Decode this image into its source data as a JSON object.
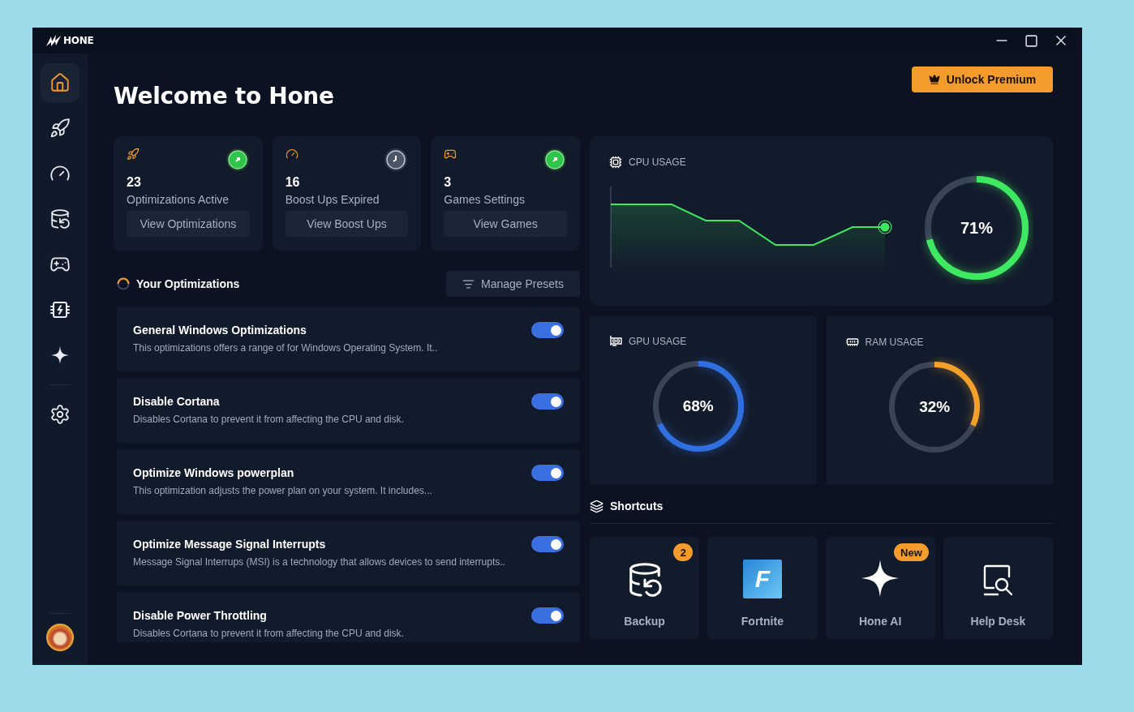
{
  "window": {
    "logo": "HONE"
  },
  "sidebar": {
    "items": [
      {
        "kind": "home",
        "selected": true
      },
      {
        "kind": "rocket",
        "selected": false
      },
      {
        "kind": "gauge",
        "selected": false
      },
      {
        "kind": "backup",
        "selected": false
      },
      {
        "kind": "gamepad",
        "selected": false
      },
      {
        "kind": "chip",
        "selected": false
      },
      {
        "kind": "sparkle",
        "selected": false
      },
      {
        "kind": "settings",
        "selected": false
      }
    ]
  },
  "header": {
    "title": "Welcome to Hone",
    "premium_button": "Unlock Premium"
  },
  "stats": [
    {
      "kind": "rocket",
      "count": "23",
      "label": "Optimizations Active",
      "button": "View Optimizations",
      "on": true
    },
    {
      "kind": "gauge",
      "count": "16",
      "label": "Boost Ups Expired",
      "button": "View Boost Ups",
      "on": false
    },
    {
      "kind": "gamepad",
      "count": "3",
      "label": "Games Settings",
      "button": "View Games",
      "on": true
    }
  ],
  "optimizations": {
    "title": "Your Optimizations",
    "presets_button": "Manage Presets",
    "items": [
      {
        "title": "General Windows Optimizations",
        "description": "This optimizations offers a range of for Windows Operating System. It..",
        "on": true
      },
      {
        "title": "Disable Cortana",
        "description": "Disables Cortana to prevent it from affecting the CPU and disk.",
        "on": true
      },
      {
        "title": "Optimize Windows powerplan",
        "description": "This optimization adjusts the power plan on your system. It includes...",
        "on": true
      },
      {
        "title": "Optimize Message Signal Interrupts",
        "description": "Message Signal Interrups (MSI) is a technology that allows devices to send interrupts..",
        "on": true
      },
      {
        "title": "Disable Power Throttling",
        "description": "Disables Cortana to prevent it from affecting the CPU and disk.",
        "on": true
      }
    ]
  },
  "usage": [
    {
      "kind": "cpu",
      "title": "CPU USAGE",
      "level": 0.71,
      "reading": "71%",
      "color": "#3ee860"
    },
    {
      "kind": "gpu",
      "title": "GPU USAGE",
      "level": 0.68,
      "reading": "68%",
      "color": "#2f6fe0"
    },
    {
      "kind": "ram",
      "title": "RAM USAGE",
      "level": 0.32,
      "reading": "32%",
      "color": "#f4a12c"
    }
  ],
  "shortcuts": {
    "title": "Shortcuts",
    "items": [
      {
        "kind": "backup",
        "label": "Backup",
        "badge": "2"
      },
      {
        "kind": "game",
        "label": "Fortnite",
        "logo": "F"
      },
      {
        "kind": "ai",
        "label": "Hone AI",
        "badge": "New"
      },
      {
        "kind": "help",
        "label": "Help Desk"
      }
    ]
  }
}
